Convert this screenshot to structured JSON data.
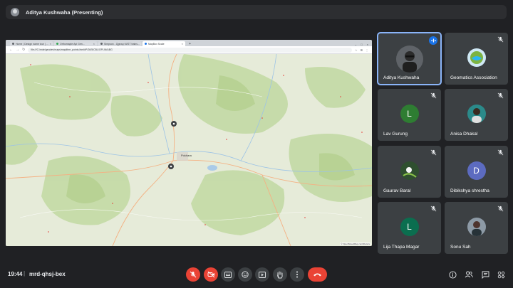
{
  "presenter_bar": {
    "title": "Aditya Kushwaha (Presenting)"
  },
  "shared_screen": {
    "tabs": [
      {
        "label": "Home | Design name tour | ..."
      },
      {
        "label": "Orthomaple Api Gen..."
      },
      {
        "label": "Simpson - Qgroup WGT trains..."
      },
      {
        "label": "MapBox Scale"
      }
    ],
    "url": "file:///C:/mde/geodev/maps/maplibre_points.html#P/26/5/CBL/OPLIN/ABG",
    "map_labels": [
      "Pokhara"
    ],
    "attribution": "© OpenStreetMap contributors"
  },
  "participants": [
    {
      "name": "Aditya Kushwaha",
      "speaking": true,
      "avatar_type": "photo",
      "avatar_color": "#5f6368"
    },
    {
      "name": "Geomatics Association",
      "speaking": false,
      "avatar_type": "logo",
      "avatar_color": "#cfe8f5"
    },
    {
      "name": "Lav Gurung",
      "speaking": false,
      "avatar_type": "letter",
      "letter": "L",
      "avatar_color": "#2e7d32"
    },
    {
      "name": "Anisa Dhakal",
      "speaking": false,
      "avatar_type": "photo",
      "avatar_color": "#2b8a8a"
    },
    {
      "name": "Gaurav Baral",
      "speaking": false,
      "avatar_type": "photo",
      "avatar_color": "#2f4f2f"
    },
    {
      "name": "Dibikshya shrestha",
      "speaking": false,
      "avatar_type": "letter",
      "letter": "D",
      "avatar_color": "#5c6bc0"
    },
    {
      "name": "Lija Thapa Magar",
      "speaking": false,
      "avatar_type": "letter",
      "letter": "L",
      "avatar_color": "#0b6e4f"
    },
    {
      "name": "Sonu Sah",
      "speaking": false,
      "avatar_type": "photo",
      "avatar_color": "#8d9aa6"
    }
  ],
  "bottom_bar": {
    "time": "19:44",
    "separator": "|",
    "meeting_code": "mrd-qhsj-bex"
  },
  "icons": {
    "mic_off": "mic-off-icon",
    "camera_off": "camera-off-icon",
    "captions": "captions-icon",
    "emoji": "emoji-icon",
    "present": "present-screen-icon",
    "raise_hand": "raise-hand-icon",
    "more": "more-options-icon",
    "end_call": "end-call-icon",
    "info": "info-icon",
    "people": "people-icon",
    "chat": "chat-icon",
    "activities": "activities-icon"
  },
  "colors": {
    "end_call": "#ea4335",
    "speaking_outline": "#8ab4f8",
    "background": "#202124"
  }
}
